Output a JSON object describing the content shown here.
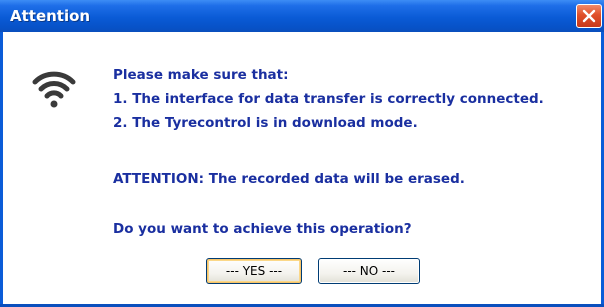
{
  "window": {
    "title": "Attention",
    "close_icon": "close-x-icon"
  },
  "message": {
    "icon": "wifi-signal-icon",
    "lines": [
      "Please make sure that:",
      "1. The interface for data transfer is correctly connected.",
      "2. The Tyrecontrol is in download mode.",
      "",
      "ATTENTION: The recorded data will be erased.",
      "",
      "Do you want to achieve this operation?"
    ]
  },
  "buttons": {
    "yes_label": "--- YES ---",
    "no_label": "--- NO ---"
  },
  "colors": {
    "title_bar": "#0a5bd6",
    "text": "#1a2fa0",
    "close_button": "#e0502a"
  }
}
